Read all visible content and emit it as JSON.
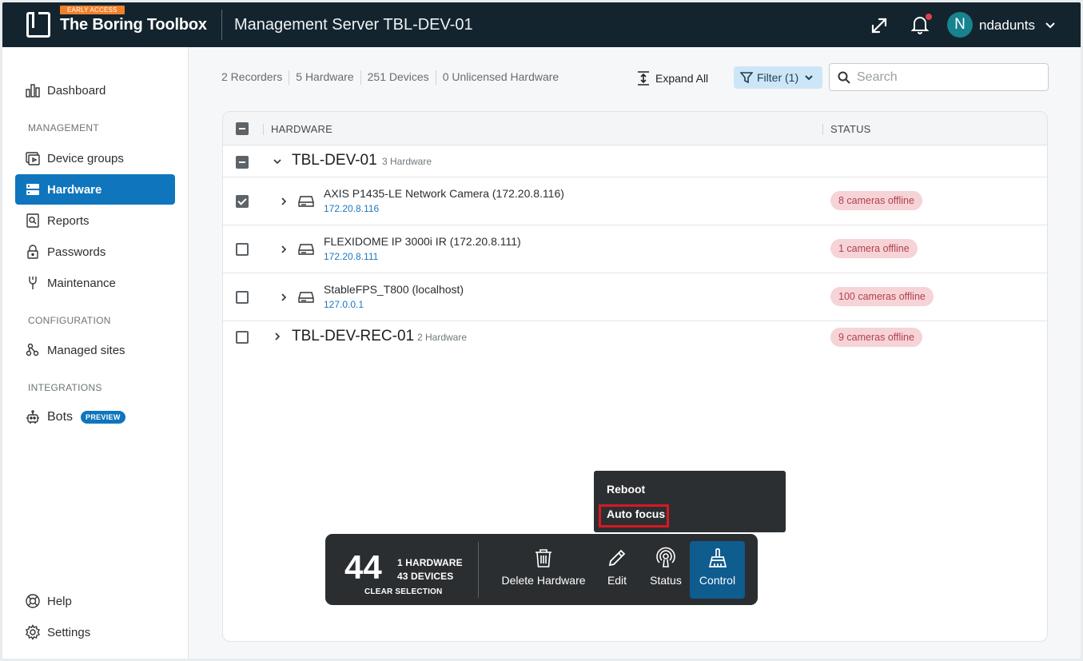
{
  "topbar": {
    "badge": "EARLY ACCESS",
    "brand": "The Boring Toolbox",
    "server_title": "Management Server TBL-DEV-01",
    "avatar_initial": "N",
    "username": "ndadunts",
    "notification_dot_color": "#e33e4b"
  },
  "sidebar": {
    "dashboard": "Dashboard",
    "section_management": "MANAGEMENT",
    "device_groups": "Device groups",
    "hardware": "Hardware",
    "reports": "Reports",
    "passwords": "Passwords",
    "maintenance": "Maintenance",
    "section_configuration": "CONFIGURATION",
    "managed_sites": "Managed sites",
    "section_integrations": "INTEGRATIONS",
    "bots": "Bots",
    "bots_badge": "PREVIEW",
    "help": "Help",
    "settings": "Settings"
  },
  "toolbar": {
    "recorders": "2 Recorders",
    "hardware": "5 Hardware",
    "devices": "251 Devices",
    "unlicensed": "0 Unlicensed Hardware",
    "expand_all": "Expand All",
    "filter": "Filter (1)",
    "search_placeholder": "Search"
  },
  "table": {
    "col_hardware": "HARDWARE",
    "col_status": "STATUS",
    "groups": [
      {
        "name": "TBL-DEV-01",
        "count": "3 Hardware",
        "expanded": true,
        "items": [
          {
            "name": "AXIS P1435-LE Network Camera (172.20.8.116)",
            "ip": "172.20.8.116",
            "status": "8 cameras offline",
            "checked": true
          },
          {
            "name": "FLEXIDOME IP 3000i IR (172.20.8.111)",
            "ip": "172.20.8.111",
            "status": "1 camera offline",
            "checked": false
          },
          {
            "name": "StableFPS_T800 (localhost)",
            "ip": "127.0.0.1",
            "status": "100 cameras offline",
            "checked": false
          }
        ]
      },
      {
        "name": "TBL-DEV-REC-01",
        "count": "2 Hardware",
        "expanded": false,
        "status": "9 cameras offline"
      }
    ]
  },
  "context_menu": {
    "items": [
      "Reboot",
      "Auto focus"
    ]
  },
  "action_bar": {
    "count": "44",
    "hardware_line": "1 HARDWARE",
    "devices_line": "43 DEVICES",
    "clear": "CLEAR SELECTION",
    "delete": "Delete Hardware",
    "edit": "Edit",
    "status": "Status",
    "control": "Control"
  },
  "colors": {
    "accent": "#0f75bd",
    "topbar": "#13242e",
    "status_badge_bg": "#f6d3d7",
    "status_badge_text": "#b1424f",
    "highlight": "#d71920"
  }
}
